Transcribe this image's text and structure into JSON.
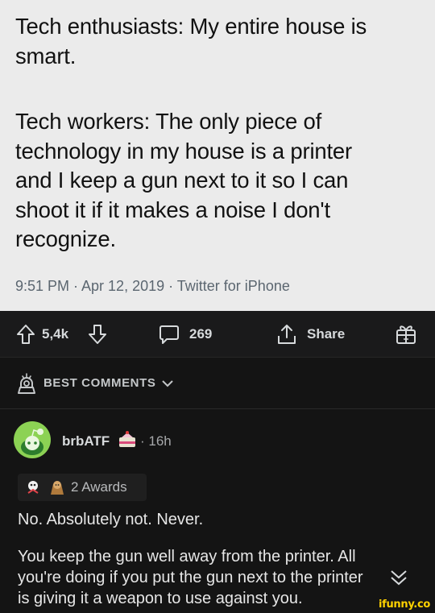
{
  "tweet": {
    "line1": "Tech enthusiasts: My entire house is\nsmart.",
    "line2": "Tech workers: The only piece of\ntechnology in my house is a printer\nand I keep a gun next to it so I can\nshoot it if it makes a noise I don't\nrecognize.",
    "meta": "9:51 PM · Apr 12, 2019 · Twitter for iPhone"
  },
  "actions": {
    "upvotes": "5,4k",
    "comments": "269",
    "share": "Share"
  },
  "sort": {
    "label": "BEST COMMENTS"
  },
  "comment": {
    "username": "brbATF",
    "time": "· 16h",
    "awards": "2 Awards",
    "para1": "No. Absolutely not. Never.",
    "para2": "You keep the gun well away from the printer. All\nyou're doing if you put the gun next to the printer\nis giving it a weapon to use against you."
  },
  "watermark": "ifunny.co",
  "colors": {
    "tweet_bg": "#ebebeb",
    "dark_bg": "#141414",
    "bar_bg": "#1a1a1b",
    "avatar": "#8cd254",
    "watermark": "#ffd200"
  },
  "icons": [
    "upvote-icon",
    "downvote-icon",
    "comment-icon",
    "share-icon",
    "gift-icon",
    "sort-icon",
    "chevron-down-icon",
    "flair-icon",
    "award-icon",
    "expand-chevron-icon"
  ]
}
